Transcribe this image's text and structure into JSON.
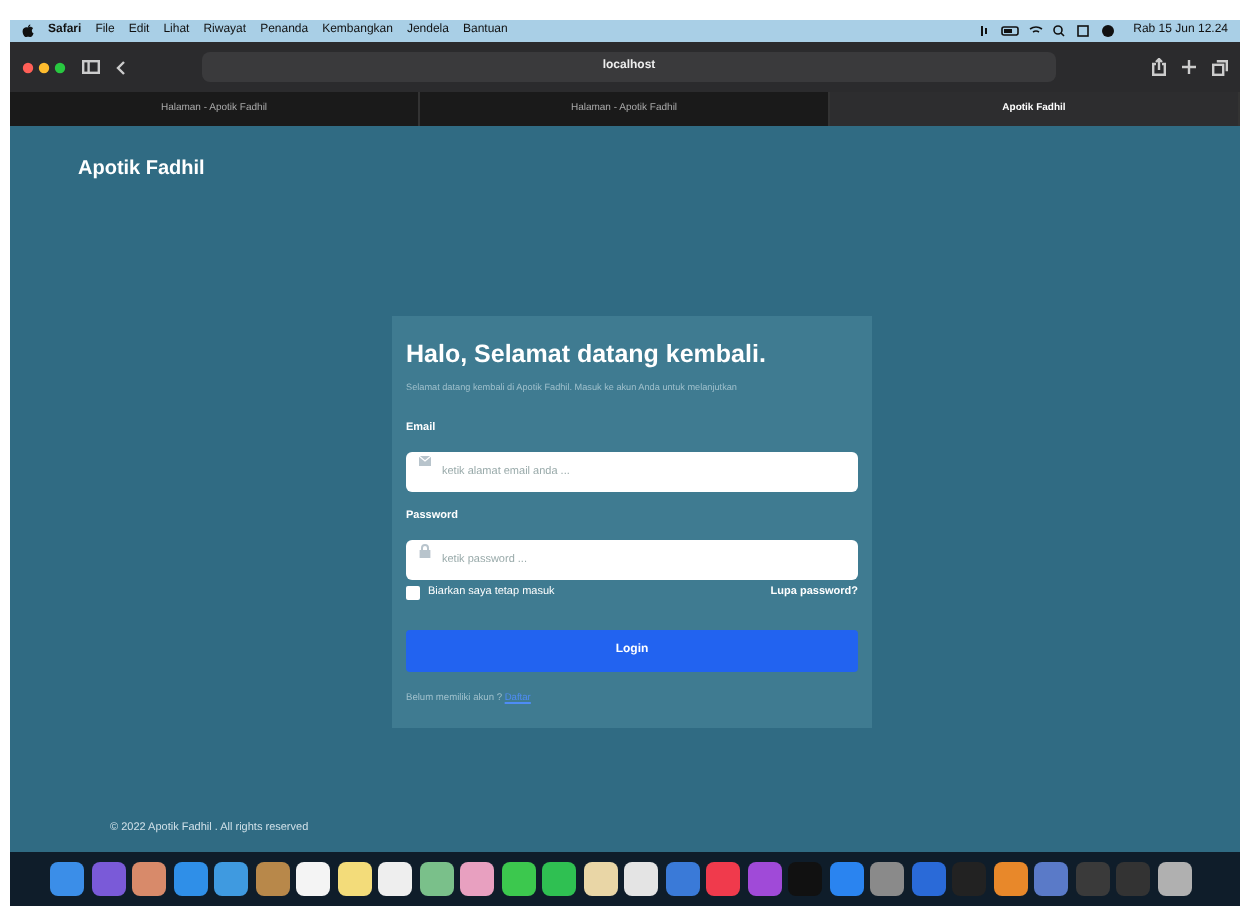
{
  "menu_bar": {
    "app": "Safari",
    "items": [
      "File",
      "Edit",
      "Lihat",
      "Riwayat",
      "Penanda",
      "Kembangkan",
      "Jendela",
      "Bantuan"
    ],
    "clock": "Rab 15 Jun 12.24"
  },
  "toolbar": {
    "address": "localhost"
  },
  "tabs": [
    {
      "label": "Halaman - Apotik Fadhil",
      "selected": false
    },
    {
      "label": "Halaman - Apotik Fadhil",
      "selected": false
    },
    {
      "label": "Apotik Fadhil",
      "selected": true
    }
  ],
  "brand": "Apotik Fadhil",
  "login": {
    "title": "Halo, Selamat datang kembali.",
    "subtitle": "Selamat datang kembali di Apotik Fadhil. Masuk ke akun Anda untuk melanjutkan",
    "fields": [
      {
        "label": "Email",
        "placeholder": "ketik alamat email anda ...",
        "kind": "email"
      },
      {
        "label": "Password",
        "placeholder": "ketik password ...",
        "kind": "password"
      }
    ],
    "remember": {
      "label": "Biarkan saya tetap masuk",
      "checked": false
    },
    "forgot": "Lupa password?",
    "button": "Login",
    "register_prompt": "Belum memiliki akun ?",
    "register_link": "Daftar"
  },
  "footer": "© 2022 Apotik Fadhil . All rights reserved",
  "dock": [
    {
      "color": "#3b8ee8"
    },
    {
      "color": "#7a5ad8"
    },
    {
      "color": "#d88a6a"
    },
    {
      "color": "#2f8fe8"
    },
    {
      "color": "#3f9ae0"
    },
    {
      "color": "#b8884a"
    },
    {
      "color": "#f4f4f4"
    },
    {
      "color": "#f3dc7a"
    },
    {
      "color": "#eeeeee"
    },
    {
      "color": "#7ac08a"
    },
    {
      "color": "#e8a0c0"
    },
    {
      "color": "#3cc84e"
    },
    {
      "color": "#2fc052"
    },
    {
      "color": "#e9d6a6"
    },
    {
      "color": "#e4e4e4"
    },
    {
      "color": "#3a7ad8"
    },
    {
      "color": "#f03a4c"
    },
    {
      "color": "#a04ad8"
    },
    {
      "color": "#111111"
    },
    {
      "color": "#2a84f0"
    },
    {
      "color": "#8a8a8a"
    },
    {
      "color": "#2a6ad8"
    },
    {
      "color": "#222222"
    },
    {
      "color": "#e8882a"
    },
    {
      "color": "#5a7ac8"
    },
    {
      "color": "#3a3a3a"
    },
    {
      "color": "#333333"
    },
    {
      "color": "#b0b0b0"
    }
  ]
}
